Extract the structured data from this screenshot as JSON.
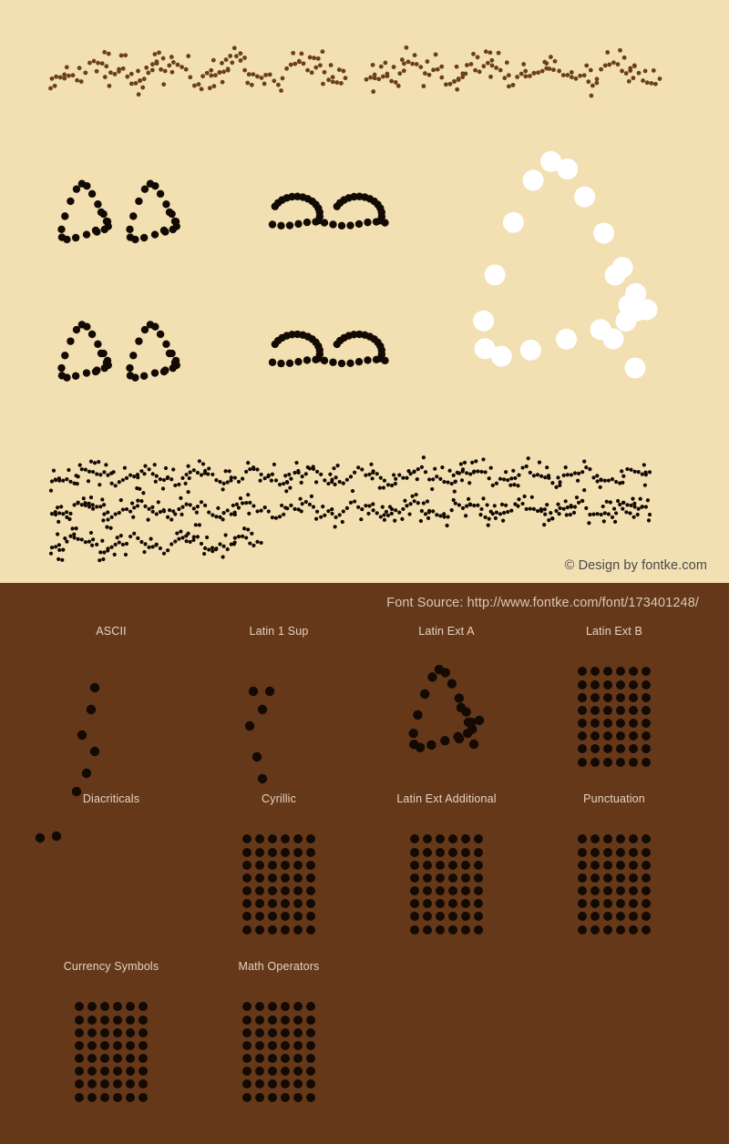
{
  "meta": {
    "page_type": "font-specimen",
    "colors": {
      "top_background": "#f2dfb2",
      "bottom_background": "#66381a",
      "dot_dark": "#120a03",
      "dot_brown": "#6b3f17",
      "dot_white": "#ffffff",
      "copyright_text": "#4a4a4a",
      "source_text": "#d8c7b4",
      "label_text": "#e2d3c2"
    }
  },
  "top": {
    "copyright": "© Design by fontke.com",
    "specimens": [
      {
        "id": "headline-left",
        "note": "dotted script headline, brown dots"
      },
      {
        "id": "headline-right",
        "note": "dotted script headline, brown dots"
      },
      {
        "id": "sample-upper-left",
        "note": "two leaf glyphs, black dots"
      },
      {
        "id": "sample-upper-mid",
        "note": "wave glyph row, black dots"
      },
      {
        "id": "big-glyph",
        "note": "large leaf glyph, white dots"
      },
      {
        "id": "sample-lower-left",
        "note": "two leaf glyphs, black dots"
      },
      {
        "id": "sample-lower-mid",
        "note": "wave glyph row, black dots"
      },
      {
        "id": "paragraph-line-1",
        "note": "dotted pangram line 1"
      },
      {
        "id": "paragraph-line-2",
        "note": "dotted pangram line 2"
      },
      {
        "id": "paragraph-line-3",
        "note": "dotted pangram line 3"
      }
    ]
  },
  "bottom": {
    "font_source": "Font Source: http://www.fontke.com/font/173401248/",
    "blocks": [
      {
        "label": "ASCII",
        "art": "sparse-ascii"
      },
      {
        "label": "Latin 1 Sup",
        "art": "sparse-latin1"
      },
      {
        "label": "Latin Ext A",
        "art": "leaf"
      },
      {
        "label": "Latin Ext B",
        "art": "grid"
      },
      {
        "label": "Diacriticals",
        "art": "two-dots"
      },
      {
        "label": "Cyrillic",
        "art": "grid"
      },
      {
        "label": "Latin Ext Additional",
        "art": "grid"
      },
      {
        "label": "Punctuation",
        "art": "grid"
      },
      {
        "label": "Currency Symbols",
        "art": "grid"
      },
      {
        "label": "Math Operators",
        "art": "grid"
      },
      {
        "label": "",
        "art": "none"
      },
      {
        "label": "",
        "art": "none"
      }
    ],
    "grid_dims": {
      "cols": 6,
      "rows": 8
    }
  }
}
